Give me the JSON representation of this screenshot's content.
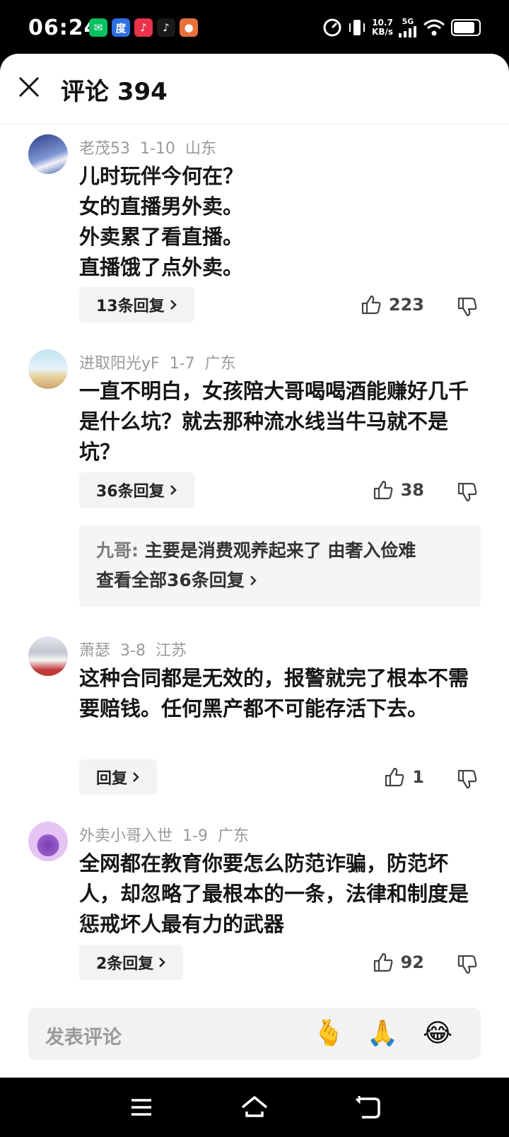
{
  "status": {
    "time": "06:24",
    "net_speed_value": "10.7",
    "net_speed_unit": "KB/s",
    "signal": "5G",
    "battery_level": 0.85,
    "apps": [
      {
        "name": "wechat",
        "color": "#07c160",
        "glyph": "✉"
      },
      {
        "name": "baidu",
        "color": "#2f6fe4",
        "glyph": "度"
      },
      {
        "name": "douyin-red",
        "color": "#e8334a",
        "glyph": "♪"
      },
      {
        "name": "douyin",
        "color": "#1a1a1a",
        "glyph": "♪"
      },
      {
        "name": "news",
        "color": "#e9703a",
        "glyph": "●"
      }
    ]
  },
  "header": {
    "title": "评论 394"
  },
  "comments": [
    {
      "author": "老茂53",
      "date": "1-10",
      "region": "山东",
      "text": "儿时玩伴今何在？\n女的直播男外卖。\n外卖累了看直播。\n直播饿了点外卖。",
      "reply_label": "13条回复",
      "likes": "223",
      "avatar_color": "#3b4a8c"
    },
    {
      "author": "进取阳光yF",
      "date": "1-7",
      "region": "广东",
      "text": "一直不明白，女孩陪大哥喝喝酒能赚好几千是什么坑？就去那种流水线当牛马就不是坑？",
      "reply_label": "36条回复",
      "likes": "38",
      "avatar_color": "#9fc6d8",
      "sub_reply": {
        "author": "九哥:",
        "text": "主要是消费观养起来了 由奢入俭难",
        "view_all": "查看全部36条回复"
      }
    },
    {
      "author": "萧瑟",
      "date": "3-8",
      "region": "江苏",
      "text": "这种合同都是无效的，报警就完了根本不需要赔钱。任何黑产都不可能存活下去。",
      "reply_label": "回复",
      "likes": "1",
      "avatar_color": "#c9ccd2"
    },
    {
      "author": "外卖小哥入世",
      "date": "1-9",
      "region": "广东",
      "text": "全网都在教育你要怎么防范诈骗，防范坏人，却忽略了最根本的一条，法律和制度是惩戒坏人最有力的武器",
      "reply_label": "2条回复",
      "likes": "92",
      "avatar_color": "#e3c4f2"
    }
  ],
  "input": {
    "placeholder": "发表评论",
    "emojis": [
      "🫰",
      "🙏",
      "😂"
    ]
  }
}
